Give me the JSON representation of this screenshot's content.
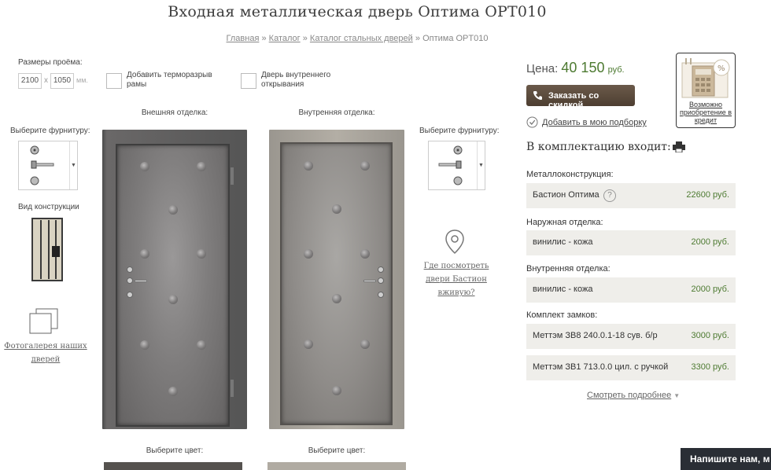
{
  "page": {
    "title": "Входная металлическая дверь Оптима OPT010"
  },
  "breadcrumb": {
    "items": [
      "Главная",
      "Каталог",
      "Каталог стальных дверей"
    ],
    "current": "Оптима OPT010",
    "separator": "»"
  },
  "options": {
    "opening_sizes_label": "Размеры проёма:",
    "width": "2100",
    "times": "x",
    "height": "1050",
    "unit": "мм.",
    "thermal_break_label": "Добавить терморазрыв рамы",
    "inward_opening_label": "Дверь внутреннего открывания"
  },
  "left": {
    "select_hardware_label": "Выберите фурнитуру:",
    "construction_label": "Вид конструкции",
    "gallery_link": "Фотогалерея наших дверей"
  },
  "doors": {
    "exterior_label": "Внешняя отделка:",
    "interior_label": "Внутренняя отделка:",
    "choose_color_label": "Выберите цвет:"
  },
  "right_hardware": {
    "select_hardware_label": "Выберите фурнитуру:",
    "where_to_see_link": "Где посмотреть двери Бастион вживую?"
  },
  "pricing": {
    "price_label": "Цена:",
    "price_value": "40 150",
    "currency": "руб.",
    "order_button": "Заказать со скидкой",
    "add_to_selection": "Добавить в мою подборку",
    "credit_text": "Возможно приобретение в кредит",
    "accent_color": "#4d7a31"
  },
  "kit": {
    "title": "В комплектацию входит:",
    "sections": [
      {
        "label": "Металлоконструкция:",
        "rows": [
          {
            "name": "Бастион Оптима",
            "price": "22600 руб.",
            "help": "?"
          }
        ]
      },
      {
        "label": "Наружная отделка:",
        "rows": [
          {
            "name": "винилис - кожа",
            "price": "2000 руб."
          }
        ]
      },
      {
        "label": "Внутренняя отделка:",
        "rows": [
          {
            "name": "винилис - кожа",
            "price": "2000 руб."
          }
        ]
      },
      {
        "label": "Комплект замков:",
        "rows": [
          {
            "name": "Меттэм ЗВ8 240.0.1-18 сув. б/р",
            "price": "3000 руб."
          },
          {
            "name": "Меттэм ЗВ1 713.0.0 цил. с ручкой",
            "price": "3300 руб."
          }
        ]
      }
    ],
    "see_more": "Смотреть подробнее"
  },
  "chat": {
    "label": "Напишите нам, м"
  }
}
